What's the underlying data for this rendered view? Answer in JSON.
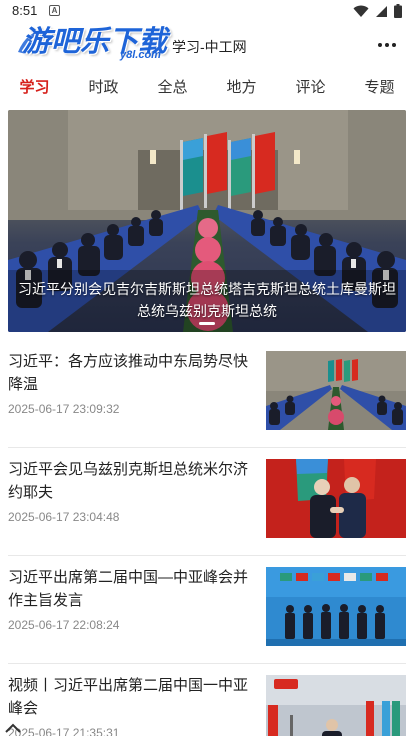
{
  "status_bar": {
    "time": "8:51",
    "notification_letter": "A"
  },
  "header": {
    "logo_text": "游吧乐下载",
    "logo_sub": "y8l.com",
    "title": "学习-中工网"
  },
  "tabs": [
    {
      "label": "学习",
      "active": true
    },
    {
      "label": "时政",
      "active": false
    },
    {
      "label": "全总",
      "active": false
    },
    {
      "label": "地方",
      "active": false
    },
    {
      "label": "评论",
      "active": false
    },
    {
      "label": "专题",
      "active": false
    }
  ],
  "hero": {
    "caption": "习近平分别会见吉尔吉斯斯坦总统塔吉克斯坦总统土库曼斯坦总统乌兹别克斯坦总统"
  },
  "news": [
    {
      "title": "习近平：各方应该推动中东局势尽快降温",
      "time": "2025-06-17 23:09:32"
    },
    {
      "title": "习近平会见乌兹别克斯坦总统米尔济约耶夫",
      "time": "2025-06-17 23:04:48"
    },
    {
      "title": "习近平出席第二届中国—中亚峰会并作主旨发言",
      "time": "2025-06-17 22:08:24"
    },
    {
      "title": "视频丨习近平出席第二届中国一中亚峰会",
      "time": "2025-06-17 21:35:31"
    }
  ],
  "colors": {
    "accent": "#d6201b",
    "logo_blue": "#1e64d8"
  }
}
